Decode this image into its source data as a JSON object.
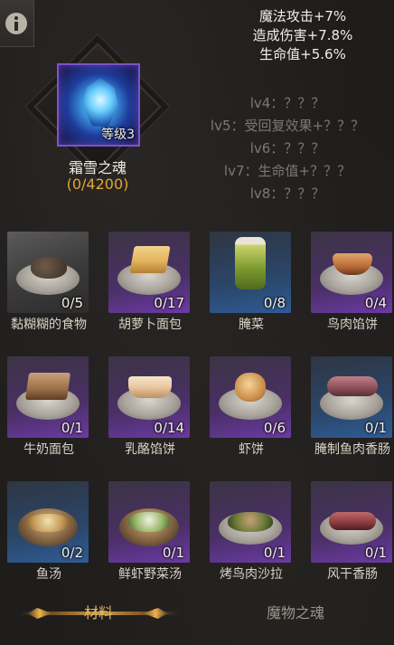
{
  "header": {
    "info_icon": "info-icon"
  },
  "soul": {
    "name": "霜雪之魂",
    "level_label": "等级3",
    "progress": "(0/4200)",
    "frame_color": "#7b54c9"
  },
  "stats": [
    "魔法攻击+7%",
    "造成伤害+7.8%",
    "生命值+5.6%"
  ],
  "levels": [
    "lv4：？？？",
    "lv5：受回复效果+？？？",
    "lv6：？？？",
    "lv7：生命值+？？？",
    "lv8：？？？"
  ],
  "items": [
    {
      "label": "黏糊糊的食物",
      "count": "0/5",
      "rarity": "gray",
      "icon": "stew-icon"
    },
    {
      "label": "胡萝卜面包",
      "count": "0/17",
      "rarity": "purple",
      "icon": "carrot-bread-icon"
    },
    {
      "label": "腌菜",
      "count": "0/8",
      "rarity": "blue",
      "icon": "pickle-jar-icon"
    },
    {
      "label": "鸟肉馅饼",
      "count": "0/4",
      "rarity": "purple",
      "icon": "bird-pie-icon"
    },
    {
      "label": "牛奶面包",
      "count": "0/1",
      "rarity": "purple",
      "icon": "milk-bread-icon"
    },
    {
      "label": "乳酪馅饼",
      "count": "0/14",
      "rarity": "purple",
      "icon": "cheese-pie-icon"
    },
    {
      "label": "虾饼",
      "count": "0/6",
      "rarity": "purple",
      "icon": "shrimp-cake-icon"
    },
    {
      "label": "腌制鱼肉香肠",
      "count": "0/1",
      "rarity": "blue",
      "icon": "fish-sausage-icon"
    },
    {
      "label": "鱼汤",
      "count": "0/2",
      "rarity": "blue",
      "icon": "fish-soup-icon"
    },
    {
      "label": "鲜虾野菜汤",
      "count": "0/1",
      "rarity": "purple",
      "icon": "shrimp-soup-icon"
    },
    {
      "label": "烤鸟肉沙拉",
      "count": "0/1",
      "rarity": "purple",
      "icon": "bird-salad-icon"
    },
    {
      "label": "风干香肠",
      "count": "0/1",
      "rarity": "purple",
      "icon": "dried-sausage-icon"
    }
  ],
  "tabs": {
    "materials": "材料",
    "monster_souls": "魔物之魂"
  },
  "colors": {
    "accent_gold": "#e9b45a",
    "progress_orange": "#e6a634",
    "rarity_purple": "#6b3aa3",
    "rarity_blue": "#2f5b97"
  }
}
